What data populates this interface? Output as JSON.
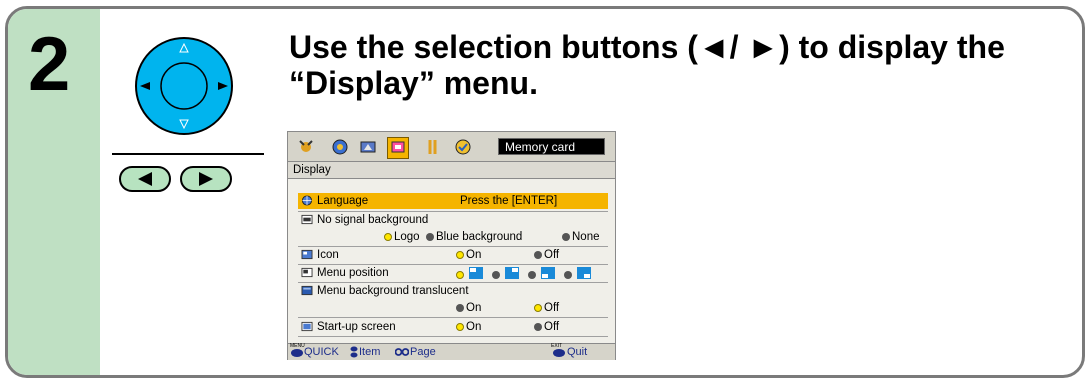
{
  "step": {
    "number": "2"
  },
  "instruction": {
    "line1": "Use the selection buttons (◄/ ►) to display the",
    "line2": "“Display” menu."
  },
  "remote": {
    "left_arrow": "◄",
    "right_arrow": "►"
  },
  "colors": {
    "accent_green": "#bfe0c3",
    "dpad_blue": "#00b4ee",
    "highlight": "#f5b400"
  },
  "osd": {
    "tab_icons": [
      "picture-icon",
      "color-icon",
      "image-icon",
      "display-icon",
      "setup-icon",
      "memory-icon"
    ],
    "memory_card": "Memory card",
    "header": "Display",
    "language": {
      "label": "Language",
      "value": "Press the [ENTER]"
    },
    "no_signal": {
      "label": "No signal background",
      "opt1": "Logo",
      "opt2": "Blue background",
      "opt3": "None"
    },
    "icon_row": {
      "label": "Icon",
      "opt1": "On",
      "opt2": "Off"
    },
    "menu_position": {
      "label": "Menu position"
    },
    "menu_bg": {
      "label": "Menu background translucent",
      "opt1": "On",
      "opt2": "Off"
    },
    "startup": {
      "label": "Start-up screen",
      "opt1": "On",
      "opt2": "Off"
    },
    "bottom": {
      "menu_tag": "MENU",
      "quick": "QUICK",
      "item": "Item",
      "page": "Page",
      "exit_tag": "EXIT",
      "quit": "Quit"
    }
  }
}
